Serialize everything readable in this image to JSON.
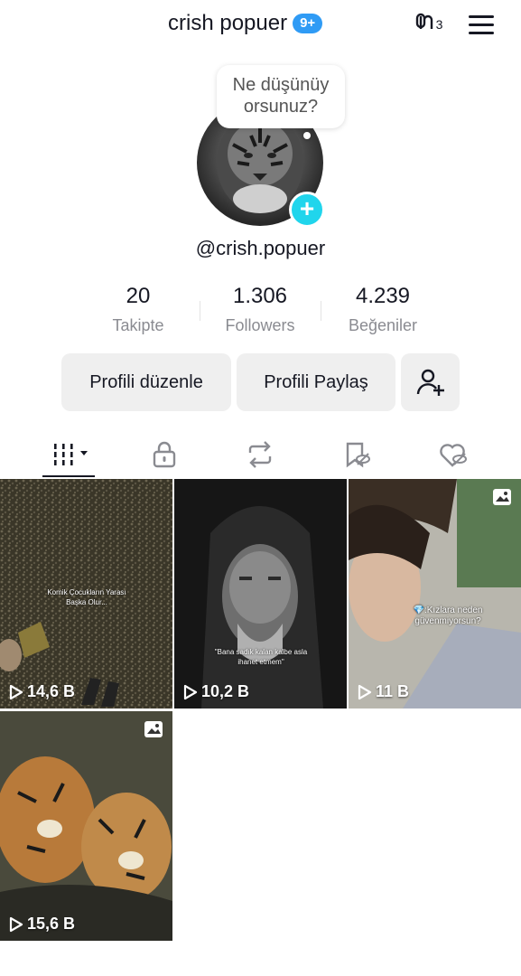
{
  "header": {
    "title": "crish popuer",
    "notification_badge": "9+",
    "threads_icon": "threads-icon",
    "threads_count": "3",
    "menu_icon": "hamburger-menu-icon"
  },
  "profile": {
    "thought_bubble": "Ne düşünüy orsunuz?",
    "username": "@crish.popuer"
  },
  "stats": [
    {
      "value": "20",
      "label": "Takipte"
    },
    {
      "value": "1.306",
      "label": "Followers"
    },
    {
      "value": "4.239",
      "label": "Beğeniler"
    }
  ],
  "actions": {
    "edit_profile": "Profili düzenle",
    "share_profile": "Profili Paylaş"
  },
  "tabs": [
    "videos-grid-icon",
    "lock-icon",
    "repost-icon",
    "favorites-icon",
    "liked-icon"
  ],
  "videos": [
    {
      "views": "14,6 B",
      "caption": "Komik Çocukların Yarası Başka Olur..."
    },
    {
      "views": "10,2 B",
      "caption": "\"Bana sadık kalan kalbe asla ihanet etmem\""
    },
    {
      "views": "11 B",
      "caption": "💎:Kızlara neden güvenmiyorsun?"
    },
    {
      "views": "15,6 B",
      "caption": ""
    }
  ],
  "colors": {
    "accent_badge": "#2f9bf5",
    "add_button": "#20d5ec",
    "button_bg": "#efefef",
    "secondary_text": "#8a8b91"
  }
}
